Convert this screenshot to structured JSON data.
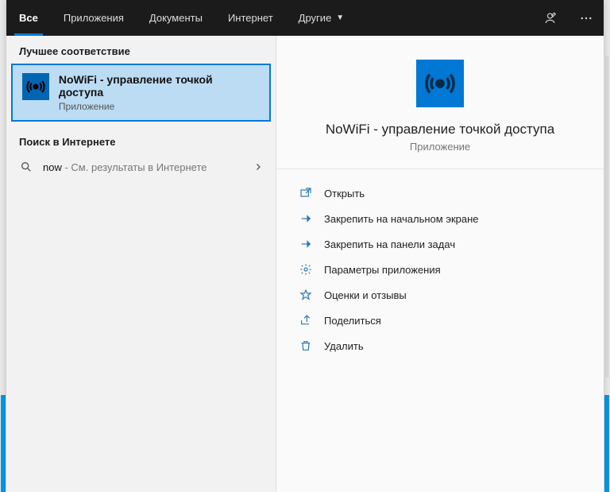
{
  "tabs": {
    "all": "Все",
    "apps": "Приложения",
    "docs": "Документы",
    "web": "Интернет",
    "more": "Другие"
  },
  "left": {
    "best_header": "Лучшее соответствие",
    "best_title": "NoWiFi - управление точкой доступа",
    "best_sub": "Приложение",
    "web_header": "Поиск в Интернете",
    "web_query": "now",
    "web_suffix": " - См. результаты в Интернете"
  },
  "right": {
    "title": "NoWiFi - управление точкой доступа",
    "sub": "Приложение",
    "actions": {
      "open": "Открыть",
      "pin_start": "Закрепить на начальном экране",
      "pin_taskbar": "Закрепить на панели задач",
      "settings": "Параметры приложения",
      "rate": "Оценки и отзывы",
      "share": "Поделиться",
      "delete": "Удалить"
    }
  }
}
